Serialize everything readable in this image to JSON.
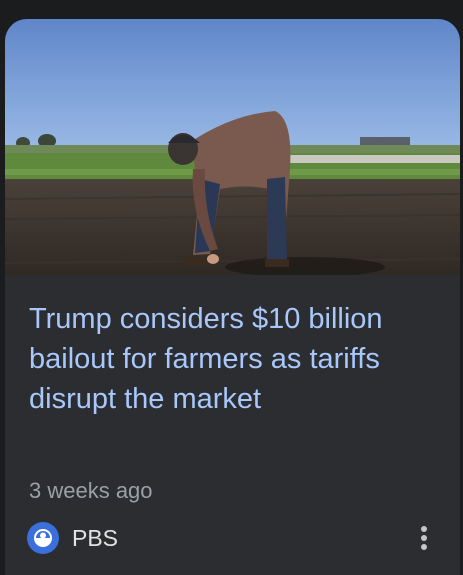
{
  "article": {
    "headline": "Trump considers $10 billion bailout for farmers as tariffs disrupt the market",
    "time": "3 weeks ago",
    "source": "PBS",
    "source_icon": "pbs-logo-icon",
    "more_icon": "more-vert-icon",
    "image": "photo of farmer bending over crouching to touch soil in a plowed field under blue sky"
  },
  "colors": {
    "background": "#1b1c1e",
    "card": "#2c2d30",
    "headline": "#a8c7fa",
    "meta": "#9aa0a6",
    "source_text": "#e3e3e3",
    "pbs_blue": "#3a6fdc"
  }
}
